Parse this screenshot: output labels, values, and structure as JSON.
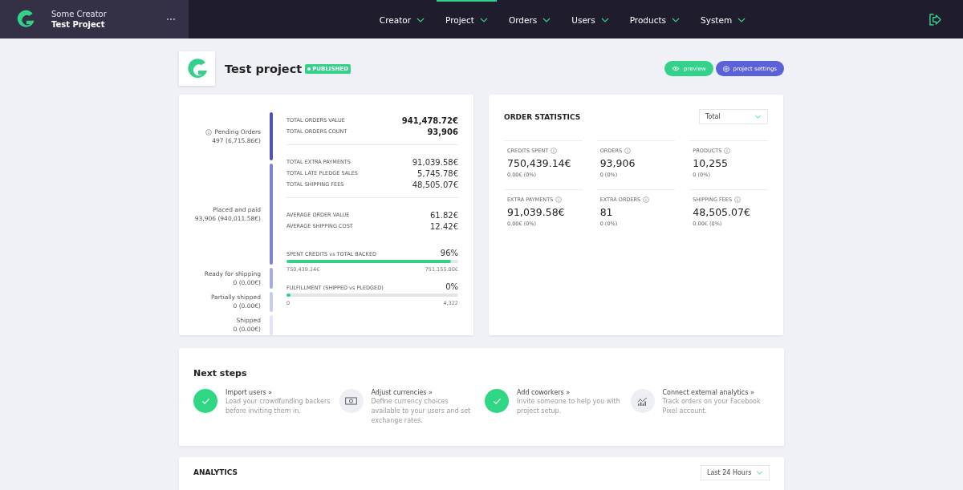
{
  "header": {
    "creator": "Some Creator",
    "project": "Test Project"
  },
  "nav": [
    {
      "label": "Creator",
      "selected": false
    },
    {
      "label": "Project",
      "selected": true
    },
    {
      "label": "Orders",
      "selected": false
    },
    {
      "label": "Users",
      "selected": false
    },
    {
      "label": "Products",
      "selected": false
    },
    {
      "label": "System",
      "selected": false
    }
  ],
  "project": {
    "title": "Test project",
    "status": "PUBLISHED"
  },
  "actions": [
    {
      "label": "preview",
      "kind": "preview"
    },
    {
      "label": "project settings",
      "kind": "settings"
    }
  ],
  "stages": [
    {
      "label": "Pending Orders",
      "value": "497 (6,715.86€)",
      "color": "#4f53b8",
      "info": true
    },
    {
      "label": "Placed and paid",
      "value": "93,906 (940,011.58€)",
      "color": "#7e82d6",
      "info": false
    },
    {
      "label": "Ready for shipping",
      "value": "0 (0.00€)",
      "color": "#a7aae0",
      "info": false
    },
    {
      "label": "Partially shipped",
      "value": "0 (0.00€)",
      "color": "#c9cbeb",
      "info": false
    },
    {
      "label": "Shipped",
      "value": "0 (0.00€)",
      "color": "#e1e3f3",
      "info": false
    }
  ],
  "summary_groups": [
    {
      "emphasis": true,
      "rows": [
        {
          "label": "TOTAL ORDERS VALUE",
          "value": "941,478.72€"
        },
        {
          "label": "TOTAL ORDERS COUNT",
          "value": "93,906"
        }
      ]
    },
    {
      "emphasis": false,
      "rows": [
        {
          "label": "TOTAL EXTRA PAYMENTS",
          "value": "91,039.58€"
        },
        {
          "label": "TOTAL LATE PLEDGE SALES",
          "value": "5,745.78€"
        },
        {
          "label": "TOTAL SHIPPING FEES",
          "value": "48,505.07€"
        }
      ]
    },
    {
      "emphasis": false,
      "rows": [
        {
          "label": "AVERAGE ORDER VALUE",
          "value": "61.82€"
        },
        {
          "label": "AVERAGE SHIPPING COST",
          "value": "12.42€"
        }
      ]
    }
  ],
  "progress": [
    {
      "label": "SPENT CREDITS vs TOTAL BACKED",
      "percent": "96%",
      "level": 0.96,
      "from": "750,439.14€",
      "to": "751,155.00€"
    },
    {
      "label": "FULFILLMENT (SHIPPED vs PLEDGED)",
      "percent": "0%",
      "level": 0,
      "from": "0",
      "to": "4,322"
    }
  ],
  "order_statistics": {
    "title": "ORDER STATISTICS",
    "period": "Total",
    "stats": [
      {
        "label": "CREDITS SPENT",
        "value": "750,439.14€",
        "change": "0.00€ (0%)"
      },
      {
        "label": "ORDERS",
        "value": "93,906",
        "change": "0 (0%)"
      },
      {
        "label": "PRODUCTS",
        "value": "10,255",
        "change": "0 (0%)"
      },
      {
        "label": "EXTRA PAYMENTS",
        "value": "91,039.58€",
        "change": "0.00€ (0%)"
      },
      {
        "label": "EXTRA ORDERS",
        "value": "81",
        "change": "0 (0%)"
      },
      {
        "label": "SHIPPING FEES",
        "value": "48,505.07€",
        "change": "0.00€ (0%)"
      }
    ]
  },
  "next_steps": {
    "title": "Next steps",
    "steps": [
      {
        "title": "Import users »",
        "text": "Load your crowdfunding backers before inviting them in.",
        "done": true
      },
      {
        "title": "Adjust currencies »",
        "text": "Define currency choices available to your users and set exchange rates.",
        "done": false,
        "kind": "currency"
      },
      {
        "title": "Add coworkers »",
        "text": "Invite someone to help you with project setup.",
        "done": true
      },
      {
        "title": "Connect external analytics »",
        "text": "Track orders on your Facebook Pixel account.",
        "done": false,
        "kind": "analytics"
      }
    ]
  },
  "analytics": {
    "title": "ANALYTICS",
    "period": "Last 24 Hours"
  }
}
